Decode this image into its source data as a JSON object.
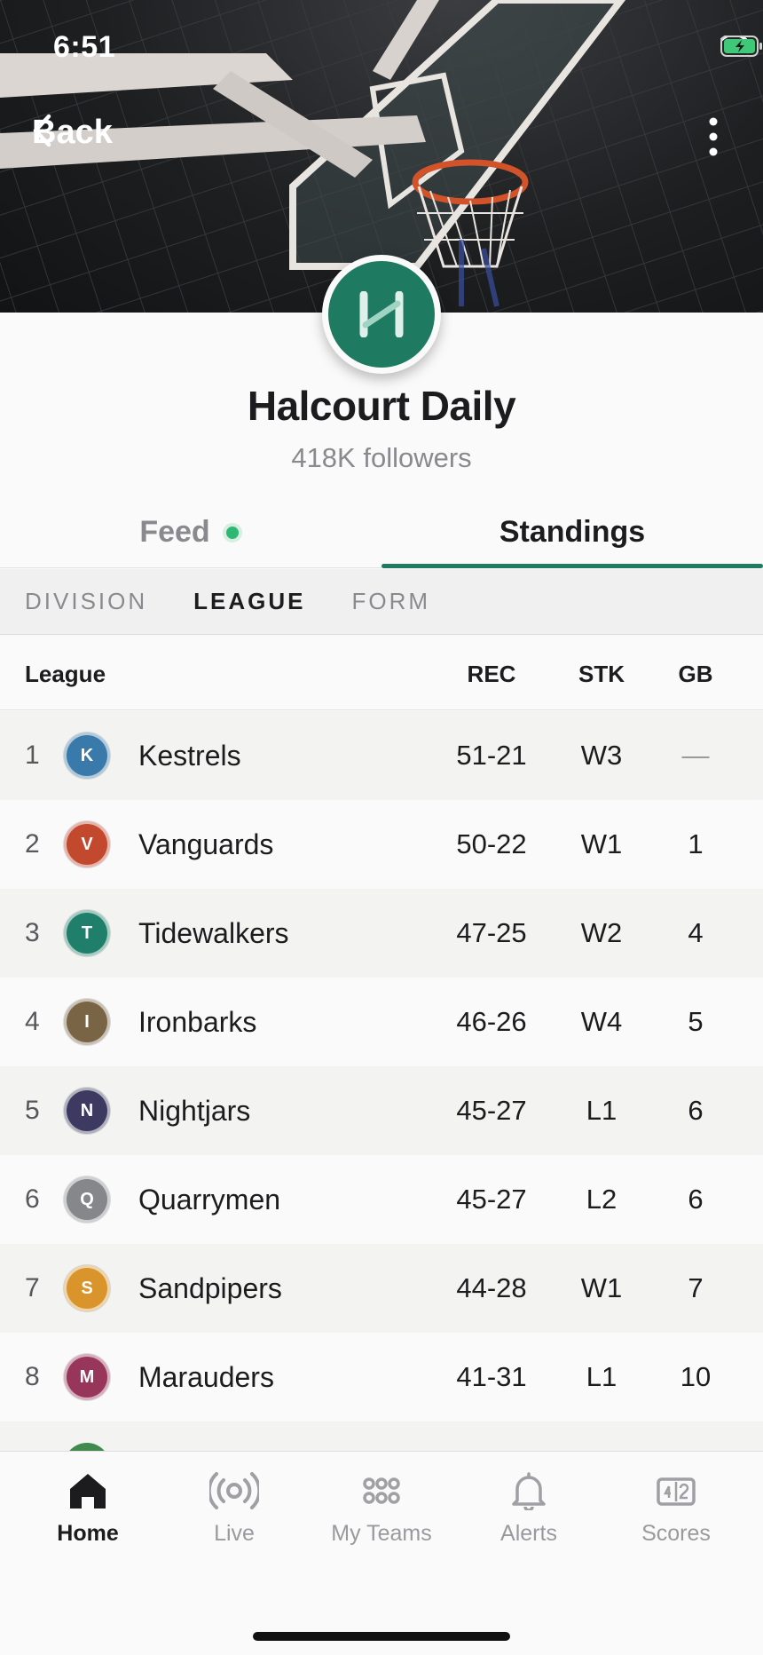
{
  "status_bar": {
    "time": "6:51"
  },
  "header": {
    "back_label": "Back"
  },
  "profile": {
    "name": "Halcourt Daily",
    "followers": "418K followers",
    "brand_color": "#1f7a62"
  },
  "tabs": [
    {
      "label": "Feed",
      "active": false,
      "has_dot": true
    },
    {
      "label": "Standings",
      "active": true
    }
  ],
  "filters": [
    {
      "label": "DIVISION",
      "selected": false
    },
    {
      "label": "LEAGUE",
      "selected": true
    },
    {
      "label": "FORM",
      "selected": false
    }
  ],
  "table": {
    "headers": {
      "team": "League",
      "rec": "REC",
      "stk": "STK",
      "gb": "GB"
    },
    "rows": [
      {
        "rank": "1",
        "initial": "K",
        "team": "Kestrels",
        "rec": "51-21",
        "stk": "W3",
        "gb": "—",
        "color": "#3a7aab"
      },
      {
        "rank": "2",
        "initial": "V",
        "team": "Vanguards",
        "rec": "50-22",
        "stk": "W1",
        "gb": "1",
        "color": "#c2482e"
      },
      {
        "rank": "3",
        "initial": "T",
        "team": "Tidewalkers",
        "rec": "47-25",
        "stk": "W2",
        "gb": "4",
        "color": "#1f7f6a"
      },
      {
        "rank": "4",
        "initial": "I",
        "team": "Ironbarks",
        "rec": "46-26",
        "stk": "W4",
        "gb": "5",
        "color": "#7a6446"
      },
      {
        "rank": "5",
        "initial": "N",
        "team": "Nightjars",
        "rec": "45-27",
        "stk": "L1",
        "gb": "6",
        "color": "#3c3a60"
      },
      {
        "rank": "6",
        "initial": "Q",
        "team": "Quarrymen",
        "rec": "45-27",
        "stk": "L2",
        "gb": "6",
        "color": "#85878b"
      },
      {
        "rank": "7",
        "initial": "S",
        "team": "Sandpipers",
        "rec": "44-28",
        "stk": "W1",
        "gb": "7",
        "color": "#d9952b"
      },
      {
        "rank": "8",
        "initial": "M",
        "team": "Marauders",
        "rec": "41-31",
        "stk": "L1",
        "gb": "10",
        "color": "#98365a"
      }
    ]
  },
  "bottom_nav": [
    {
      "label": "Home",
      "icon": "home-icon",
      "active": true
    },
    {
      "label": "Live",
      "icon": "broadcast-icon",
      "active": false
    },
    {
      "label": "My Teams",
      "icon": "grid-icon",
      "active": false
    },
    {
      "label": "Alerts",
      "icon": "bell-icon",
      "active": false
    },
    {
      "label": "Scores",
      "icon": "scoreboard-icon",
      "active": false
    }
  ]
}
